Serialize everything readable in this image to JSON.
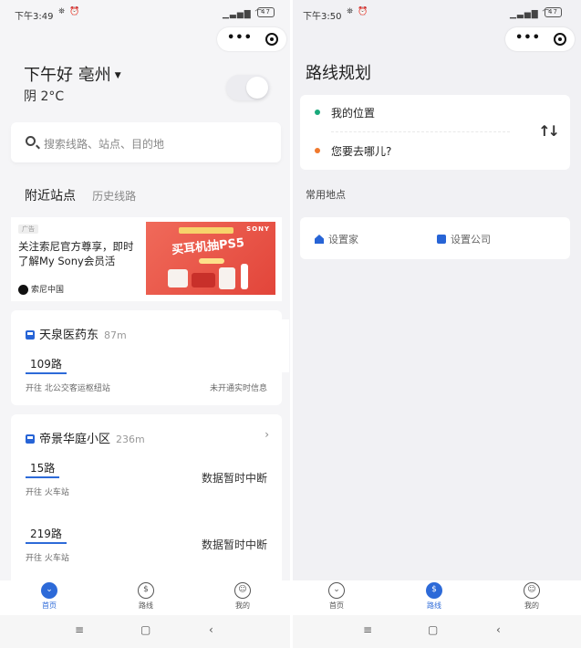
{
  "left_screen": {
    "statusbar": {
      "time": "下午3:49",
      "icons": "⛯ ⏰",
      "signal": "▁▃▅▇ ⌒",
      "battery": "47"
    },
    "header": {
      "greeting": "下午好 亳州",
      "weather": "阴 2°C"
    },
    "search": {
      "placeholder": "搜索线路、站点、目的地"
    },
    "tabs": {
      "nearby": "附近站点",
      "history": "历史线路"
    },
    "ad": {
      "tag": "广告",
      "text": "关注索尼官方尊享，即时了解My Sony会员活",
      "brand": "索尼中国",
      "image_headline": "买耳机抽PS5",
      "image_brand": "SONY"
    },
    "stops": [
      {
        "name": "天泉医药东",
        "distance": "87m",
        "routes": [
          {
            "line": "109路",
            "towards": "开往 北公交客运枢纽站",
            "status": "未开通实时信息"
          }
        ]
      },
      {
        "name": "帝景华庭小区",
        "distance": "236m",
        "chevron": "›",
        "routes": [
          {
            "line": "15路",
            "towards": "开往 火车站",
            "status": "数据暂时中断"
          },
          {
            "line": "219路",
            "towards": "开往 火车站",
            "status": "数据暂时中断"
          }
        ]
      }
    ],
    "tabbar": {
      "home": "首页",
      "route": "路线",
      "mine": "我的",
      "active": "home"
    }
  },
  "right_screen": {
    "statusbar": {
      "time": "下午3:50",
      "icons": "⛯ ⏰",
      "signal": "▁▃▅▇ ⌒",
      "battery": "47"
    },
    "title": "路线规划",
    "from": "我的位置",
    "to": "您要去哪儿?",
    "swap_icon": "↑↓",
    "common_label": "常用地点",
    "set_home": "设置家",
    "set_office": "设置公司",
    "tabbar": {
      "home": "首页",
      "route": "路线",
      "mine": "我的",
      "active": "route"
    }
  },
  "navbar": {
    "menu": "≡",
    "home": "▢",
    "back": "‹"
  },
  "colors": {
    "accent": "#2d6ad8",
    "from_dot": "#19a97b",
    "to_dot": "#f0792d",
    "ad_bg": "#e2453a"
  }
}
